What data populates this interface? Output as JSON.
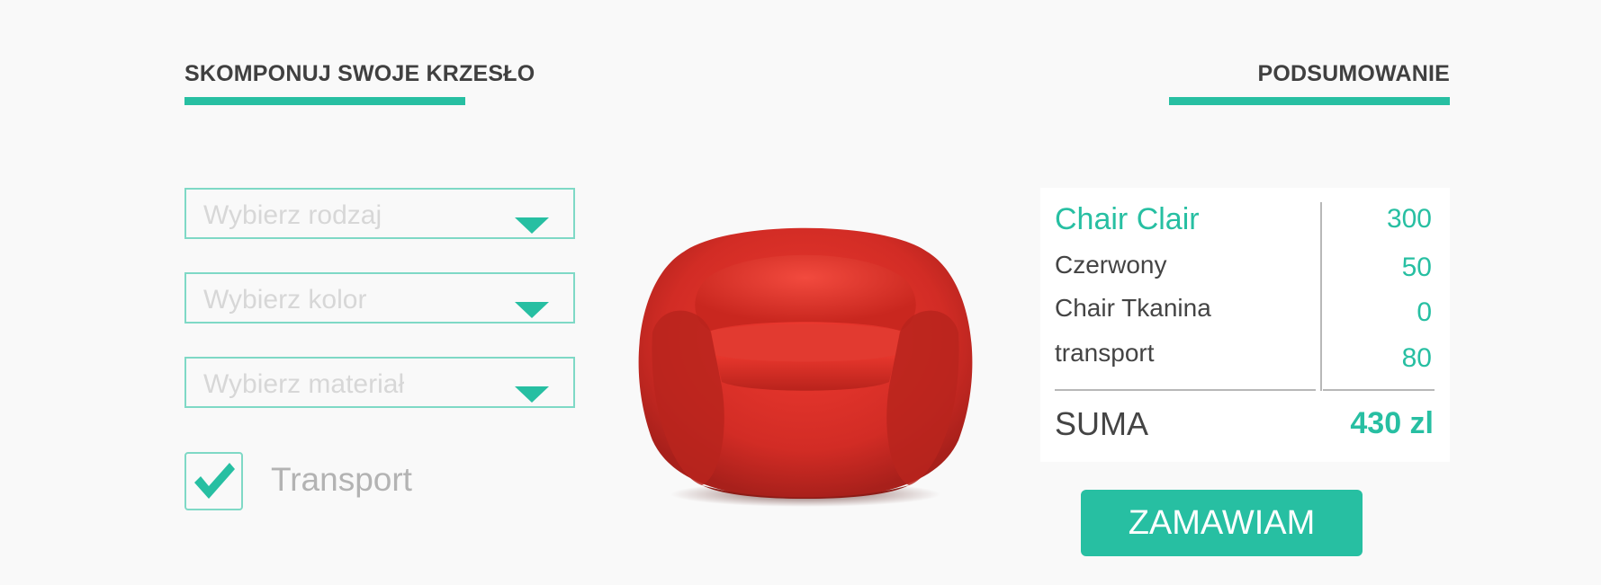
{
  "headings": {
    "left": "SKOMPONUJ SWOJE KRZESŁO",
    "right": "PODSUMOWANIE"
  },
  "selects": [
    {
      "placeholder": "Wybierz rodzaj"
    },
    {
      "placeholder": "Wybierz kolor"
    },
    {
      "placeholder": "Wybierz materiał"
    }
  ],
  "transport": {
    "label": "Transport",
    "checked": true
  },
  "summary": {
    "rows": [
      {
        "label": "Chair Clair",
        "value": "300"
      },
      {
        "label": "Czerwony",
        "value": "50"
      },
      {
        "label": "Chair Tkanina",
        "value": "0"
      },
      {
        "label": "transport",
        "value": "80"
      }
    ],
    "total_label": "SUMA",
    "total_value": "430 zl"
  },
  "order_button": "ZAMAWIAM",
  "colors": {
    "accent": "#27bfa2",
    "chair": "#d9302a",
    "text": "#404040"
  },
  "icons": [
    "check-icon",
    "dropdown-arrow-icon"
  ],
  "image": {
    "subject": "red-armchair"
  }
}
